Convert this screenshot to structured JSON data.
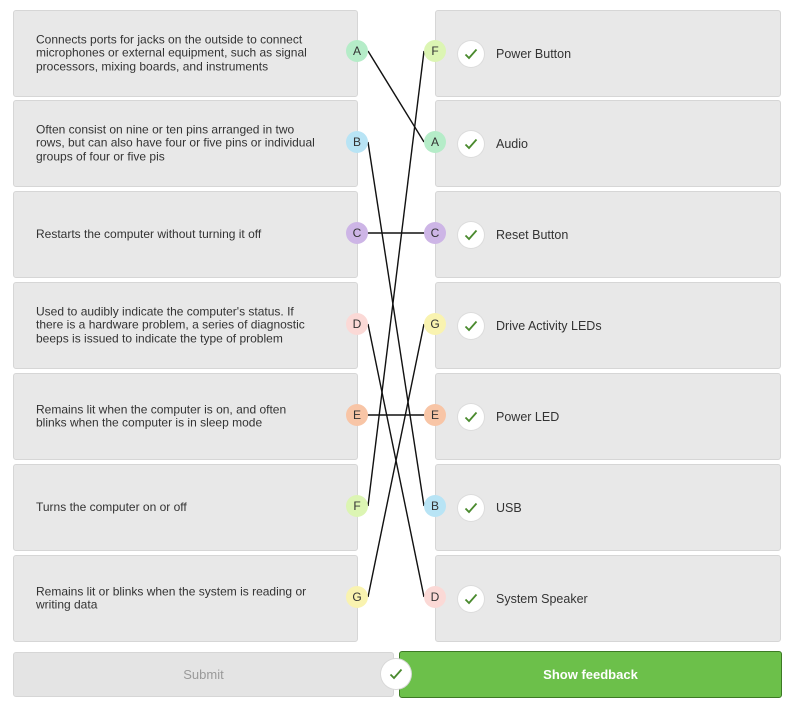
{
  "colors": {
    "A": "#b5ecc8",
    "B": "#b8e4f5",
    "C": "#cdb5e6",
    "D": "#fbd9d6",
    "E": "#f8c5a6",
    "F": "#dcf5b3",
    "G": "#f9f3b0",
    "check": "#4a8a2e",
    "feedback_bg": "#6cc04a",
    "line": "#111111"
  },
  "descriptions": [
    {
      "letter": "A",
      "text": "Connects ports for jacks on the outside to connect microphones or external equipment, such as signal processors, mixing boards, and instruments"
    },
    {
      "letter": "B",
      "text": "Often consist on nine or ten pins arranged in two rows, but can also have four or five pins or individual groups of four or five pis"
    },
    {
      "letter": "C",
      "text": "Restarts the computer without turning it off"
    },
    {
      "letter": "D",
      "text": "Used to audibly indicate the computer's status. If there is a hardware problem, a series of diagnostic beeps is issued to indicate the type of problem"
    },
    {
      "letter": "E",
      "text": "Remains lit when the computer is on, and often blinks when the computer is in sleep mode"
    },
    {
      "letter": "F",
      "text": "Turns the computer on or off"
    },
    {
      "letter": "G",
      "text": "Remains lit or blinks when the system is reading or writing data"
    }
  ],
  "answers": [
    {
      "letter": "F",
      "label": "Power Button",
      "check_icon": "check-icon"
    },
    {
      "letter": "A",
      "label": "Audio",
      "check_icon": "check-icon"
    },
    {
      "letter": "C",
      "label": "Reset Button",
      "check_icon": "check-icon"
    },
    {
      "letter": "G",
      "label": "Drive Activity LEDs",
      "check_icon": "check-icon"
    },
    {
      "letter": "E",
      "label": "Power LED",
      "check_icon": "check-icon"
    },
    {
      "letter": "B",
      "label": "USB",
      "check_icon": "check-icon"
    },
    {
      "letter": "D",
      "label": "System Speaker",
      "check_icon": "check-icon"
    }
  ],
  "buttons": {
    "submit_label": "Submit",
    "feedback_label": "Show feedback"
  }
}
